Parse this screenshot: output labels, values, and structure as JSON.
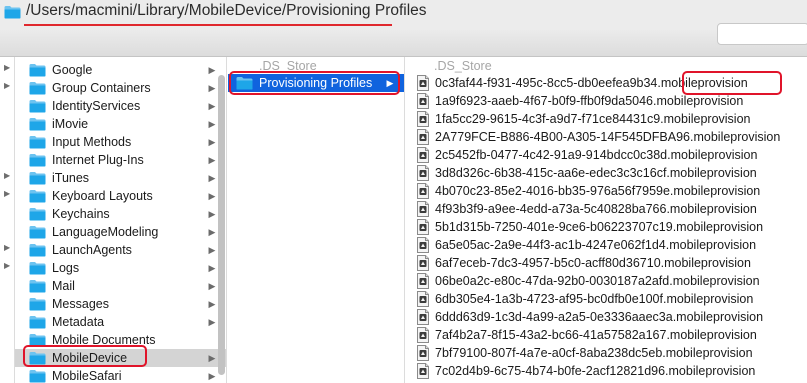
{
  "window": {
    "path_title": "/Users/macmini/Library/MobileDevice/Provisioning Profiles",
    "title_icon": "folder-icon"
  },
  "toolbar": {
    "search_placeholder": ""
  },
  "column_library": {
    "items": [
      {
        "label": "Google",
        "icon": "folder-icon",
        "has_children": true
      },
      {
        "label": "Group Containers",
        "icon": "folder-icon",
        "has_children": true
      },
      {
        "label": "IdentityServices",
        "icon": "folder-icon",
        "has_children": true
      },
      {
        "label": "iMovie",
        "icon": "folder-icon",
        "has_children": true
      },
      {
        "label": "Input Methods",
        "icon": "folder-icon",
        "has_children": true
      },
      {
        "label": "Internet Plug-Ins",
        "icon": "folder-icon",
        "has_children": true
      },
      {
        "label": "iTunes",
        "icon": "folder-icon",
        "has_children": true
      },
      {
        "label": "Keyboard Layouts",
        "icon": "folder-icon",
        "has_children": true
      },
      {
        "label": "Keychains",
        "icon": "folder-icon",
        "has_children": true
      },
      {
        "label": "LanguageModeling",
        "icon": "folder-icon",
        "has_children": true
      },
      {
        "label": "LaunchAgents",
        "icon": "folder-icon",
        "has_children": true
      },
      {
        "label": "Logs",
        "icon": "folder-icon",
        "has_children": true
      },
      {
        "label": "Mail",
        "icon": "folder-icon",
        "has_children": true
      },
      {
        "label": "Messages",
        "icon": "folder-icon",
        "has_children": true
      },
      {
        "label": "Metadata",
        "icon": "folder-icon",
        "has_children": true
      },
      {
        "label": "Mobile Documents",
        "icon": "folder-icon",
        "has_children": false
      },
      {
        "label": "MobileDevice",
        "icon": "folder-icon",
        "has_children": true,
        "selected": true
      },
      {
        "label": "MobileSafari",
        "icon": "folder-icon",
        "has_children": true
      }
    ]
  },
  "column_mobiledevice": {
    "ds_store": ".DS_Store",
    "selected_folder": "Provisioning Profiles"
  },
  "column_profiles": {
    "ds_store": ".DS_Store",
    "files": [
      "0c3faf44-f931-495c-8cc5-db0eefea9b34.mobileprovision",
      "1a9f6923-aaeb-4f67-b0f9-ffb0f9da5046.mobileprovision",
      "1fa5cc29-9615-4c3f-a9d7-f71ce84431c9.mobileprovision",
      "2A779FCE-B886-4B00-A305-14F545DFBA96.mobileprovision",
      "2c5452fb-0477-4c42-91a9-914bdcc0c38d.mobileprovision",
      "3d8d326c-6b38-415c-aa6e-edec3c3c16cf.mobileprovision",
      "4b070c23-85e2-4016-bb35-976a56f7959e.mobileprovision",
      "4f93b3f9-a9ee-4edd-a73a-5c40828ba766.mobileprovision",
      "5b1d315b-7250-401e-9ce6-b06223707c19.mobileprovision",
      "6a5e05ac-2a9e-44f3-ac1b-4247e062f1d4.mobileprovision",
      "6af7eceb-7dc3-4957-b5c0-acff80d36710.mobileprovision",
      "06be0a2c-e80c-47da-92b0-0030187a2afd.mobileprovision",
      "6db305e4-1a3b-4723-af95-bc0dfb0e100f.mobileprovision",
      "6ddd63d9-1c3d-4a99-a2a5-0e3336aaec3a.mobileprovision",
      "7af4b2a7-8f15-43a2-bc66-41a57582a167.mobileprovision",
      "7bf79100-807f-4a7e-a0cf-8aba238dc5eb.mobileprovision",
      "7c02d4b9-6c75-4b74-b0fe-2acf12821d96.mobileprovision"
    ],
    "file_icon": "provisioning-profile-icon"
  },
  "colors": {
    "annotation_red": "#e0142a",
    "selection_blue": "#1063de",
    "folder_blue": "#1ba1e2"
  }
}
